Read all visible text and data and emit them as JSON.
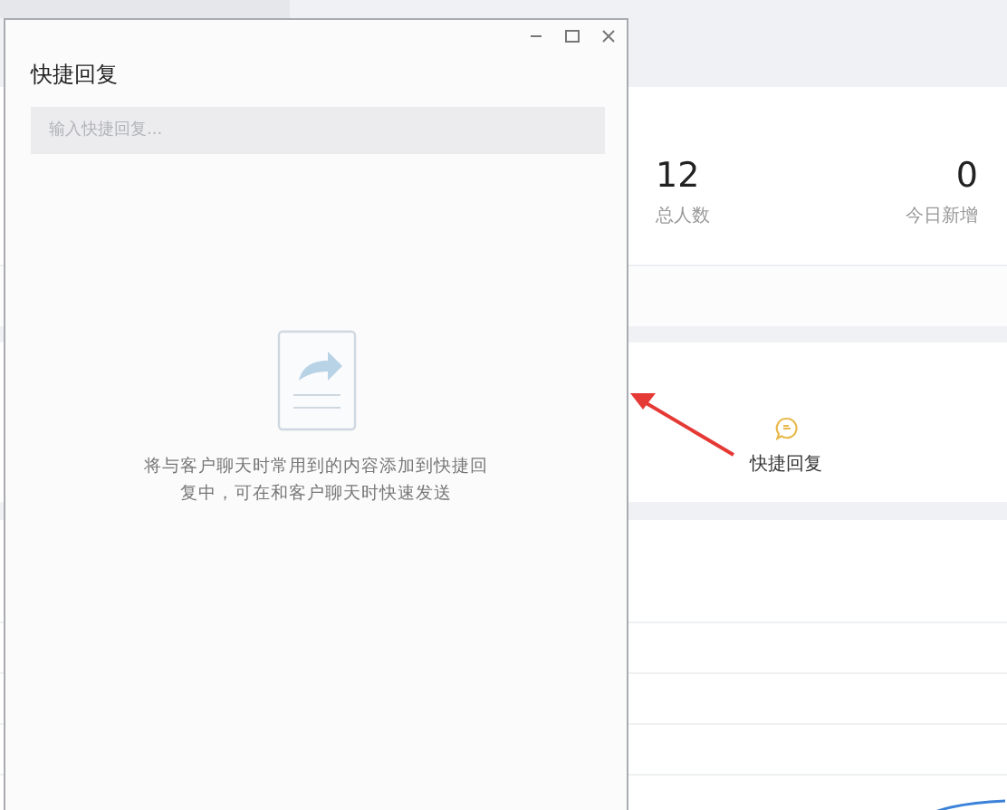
{
  "stats": [
    {
      "value": "12",
      "label": "总人数"
    },
    {
      "value": "0",
      "label": "今日新增"
    }
  ],
  "features": [
    {
      "label": "快捷回复"
    }
  ],
  "dialog": {
    "title": "快捷回复",
    "search": {
      "placeholder": "输入快捷回复..."
    },
    "empty_message": "将与客户聊天时常用到的内容添加到快捷回复中，可在和客户聊天时快速发送"
  }
}
